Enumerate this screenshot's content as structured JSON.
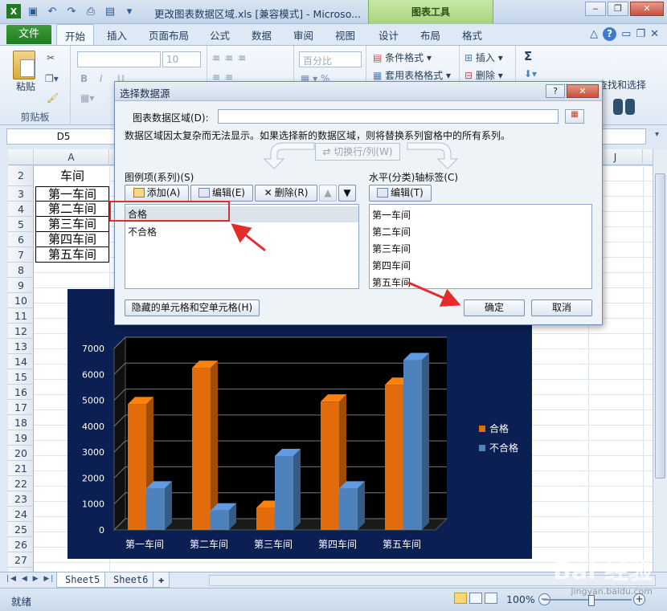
{
  "window": {
    "title": "更改图表数据区域.xls  [兼容模式] - Microso...",
    "chart_tools": "图表工具"
  },
  "tabs": {
    "file": "文件",
    "items": [
      "开始",
      "插入",
      "页面布局",
      "公式",
      "数据",
      "审阅",
      "视图",
      "设计",
      "布局",
      "格式"
    ],
    "active_index": 0
  },
  "ribbon": {
    "paste": "粘贴",
    "clipboard": "剪贴板",
    "font_size": "10",
    "number_format": "百分比",
    "conditional_format": "条件格式",
    "table_format": "套用表格格式",
    "insert": "插入",
    "delete": "删除",
    "find_select": "查找和选择",
    "bold": "B",
    "italic": "I",
    "underline": "U",
    "sigma": "Σ"
  },
  "formula_bar": {
    "name_box": "D5",
    "formula": ""
  },
  "grid": {
    "col_a": "A",
    "col_j": "J",
    "rows": [
      "2",
      "3",
      "4",
      "5",
      "6",
      "7",
      "8",
      "9",
      "10",
      "11",
      "12",
      "13",
      "14",
      "15",
      "16",
      "17",
      "18",
      "19",
      "20",
      "21",
      "22",
      "23",
      "24",
      "25",
      "26",
      "27"
    ],
    "cells": [
      "车间",
      "第一车间",
      "第二车间",
      "第三车间",
      "第四车间",
      "第五车间"
    ]
  },
  "sheets": {
    "tabs": [
      "Sheet5",
      "Sheet6"
    ],
    "active": "Sheet5"
  },
  "status": {
    "ready": "就绪",
    "zoom": "100%"
  },
  "dialog": {
    "title": "选择数据源",
    "range_label": "图表数据区域(D):",
    "info": "数据区域因太复杂而无法显示。如果选择新的数据区域，则将替换系列窗格中的所有系列。",
    "switch_label": "切换行/列(W)",
    "legend_label": "图例项(系列)(S)",
    "add": "添加(A)",
    "edit": "编辑(E)",
    "remove": "删除(R)",
    "series": [
      "合格",
      "不合格"
    ],
    "axis_label": "水平(分类)轴标签(C)",
    "axis_edit": "编辑(T)",
    "categories": [
      "第一车间",
      "第二车间",
      "第三车间",
      "第四车间",
      "第五车间"
    ],
    "hidden_cells": "隐藏的单元格和空单元格(H)",
    "ok": "确定",
    "cancel": "取消",
    "help": "?",
    "close": "✕"
  },
  "colors": {
    "series_ok": "#e36c0a",
    "series_fail": "#4f81bd",
    "chart_bg": "#0c1f52",
    "plot_bg": "#000000",
    "annotation": "#e52b2b"
  },
  "chart_data": {
    "type": "bar",
    "categories": [
      "第一车间",
      "第二车间",
      "第三车间",
      "第四车间",
      "第五车间"
    ],
    "series": [
      {
        "name": "合格",
        "values": [
          4850,
          6250,
          850,
          4950,
          5600
        ]
      },
      {
        "name": "不合格",
        "values": [
          1600,
          750,
          2850,
          1600,
          6550
        ]
      }
    ],
    "yticks": [
      0,
      1000,
      2000,
      3000,
      4000,
      5000,
      6000,
      7000
    ],
    "ylim": [
      0,
      7000
    ],
    "legend": "right",
    "grid": true
  },
  "watermark": {
    "text": "Bai 经验",
    "url": "jingyan.baidu.com"
  }
}
